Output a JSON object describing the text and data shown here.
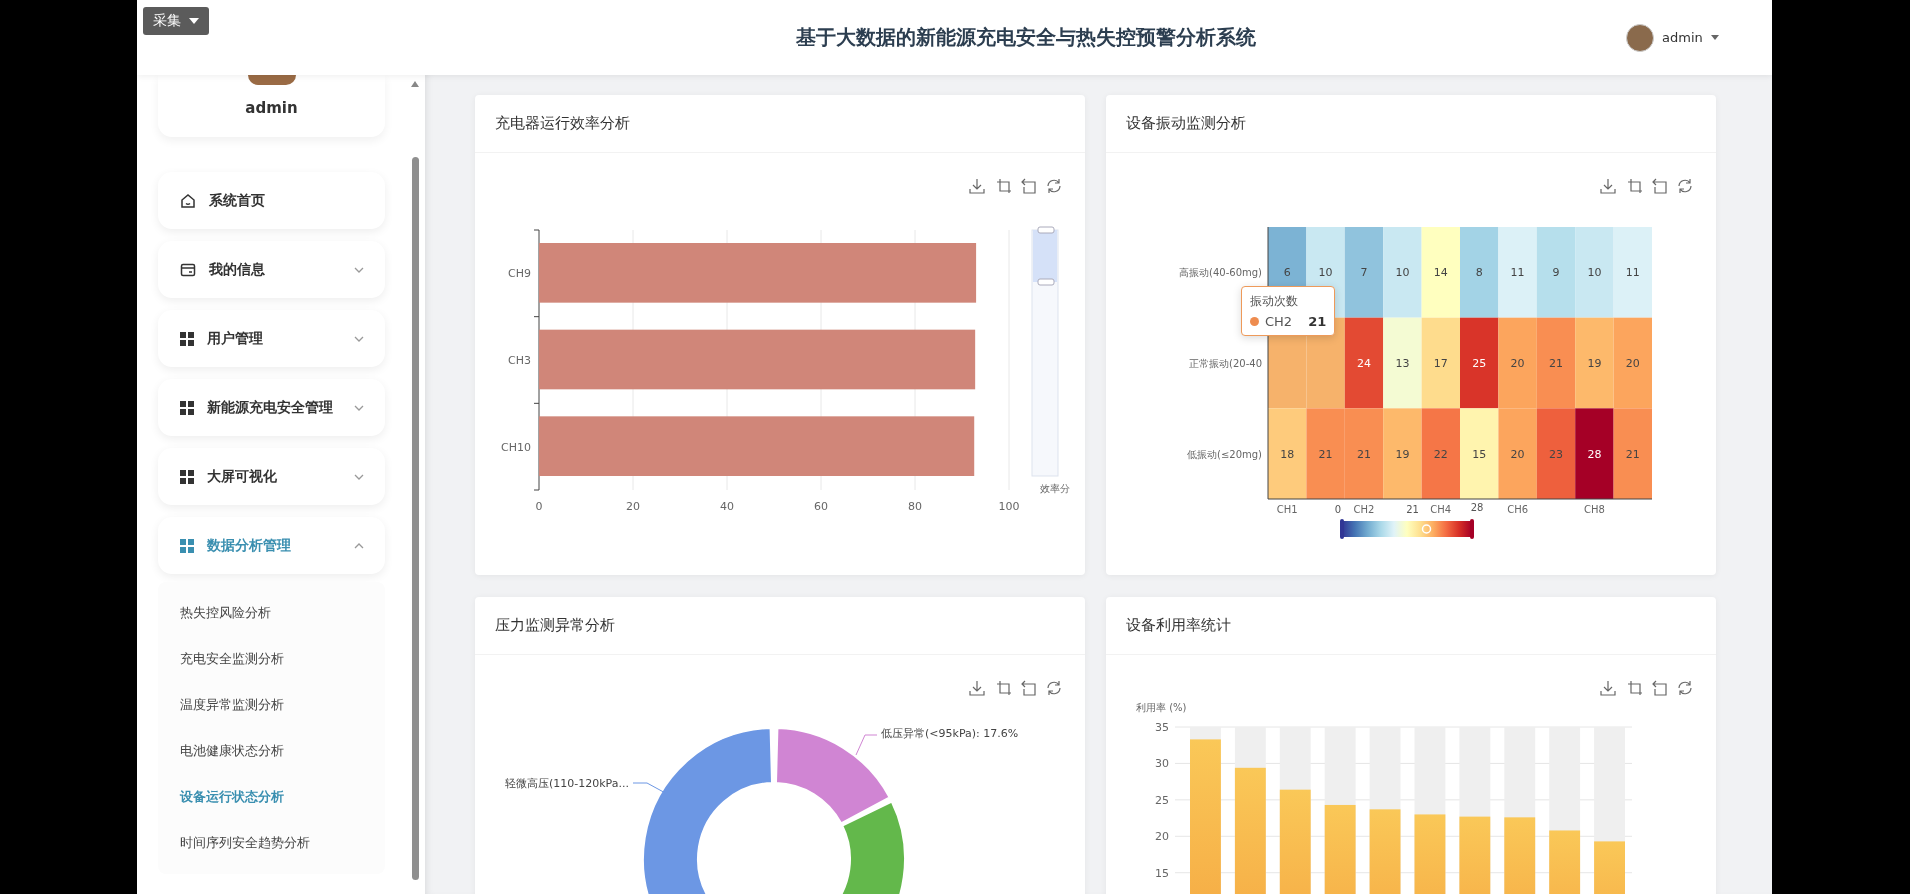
{
  "top_button": {
    "label": "采集"
  },
  "header": {
    "title": "基于大数据的新能源充电安全与热失控预警分析系统",
    "user": "admin"
  },
  "sidebar": {
    "profile": {
      "name": "admin"
    },
    "menu": [
      {
        "label": "系统首页",
        "kind": "home"
      },
      {
        "label": "我的信息",
        "kind": "card",
        "expanded": false
      },
      {
        "label": "用户管理",
        "kind": "grid",
        "expanded": false
      },
      {
        "label": "新能源充电安全管理",
        "kind": "grid",
        "expanded": false
      },
      {
        "label": "大屏可视化",
        "kind": "grid",
        "expanded": false
      },
      {
        "label": "数据分析管理",
        "kind": "grid",
        "expanded": true,
        "children": [
          {
            "label": "热失控风险分析",
            "selected": false
          },
          {
            "label": "充电安全监测分析",
            "selected": false
          },
          {
            "label": "温度异常监测分析",
            "selected": false
          },
          {
            "label": "电池健康状态分析",
            "selected": false
          },
          {
            "label": "设备运行状态分析",
            "selected": true
          },
          {
            "label": "时间序列安全趋势分析",
            "selected": false
          }
        ]
      }
    ]
  },
  "cards": [
    {
      "kind": "hbar",
      "title": "充电器运行效率分析",
      "slider_label": "效率分",
      "chart_data": {
        "type": "bar",
        "orientation": "horizontal",
        "categories": [
          "CH9",
          "CH3",
          "CH10"
        ],
        "values": [
          93,
          92.8,
          92.6
        ],
        "grid": true,
        "xlim": [
          0,
          100
        ],
        "xticks": [
          0,
          20,
          40,
          60,
          80,
          100
        ]
      }
    },
    {
      "kind": "heatmap",
      "title": "设备振动监测分析",
      "y_categories": [
        "高振动(40-60mg)",
        "正常振动(20-40",
        "低振动(≤20mg)"
      ],
      "rows": [
        [
          "6",
          "10",
          "7",
          "10",
          "14",
          "8",
          "11",
          "9",
          "10",
          "11"
        ],
        [
          null,
          null,
          "24",
          "13",
          "17",
          "25",
          "20",
          "21",
          "19",
          "20"
        ],
        [
          "18",
          "21",
          "21",
          "19",
          "22",
          "15",
          "20",
          "23",
          "28",
          "21"
        ]
      ],
      "x_labels": [
        "CH1",
        "CH2",
        "CH4",
        "CH6",
        "CH8"
      ],
      "visual_map": {
        "min": "0",
        "max": "28",
        "handle": "21",
        "level": 0.65
      },
      "tooltip": {
        "title": "振动次数",
        "series": "CH2",
        "value": "21"
      }
    },
    {
      "kind": "donut",
      "title": "压力监测异常分析",
      "labels": [
        "低压异常(<95kPa): 17.6%",
        "轻微高压(110-120kPa..."
      ]
    },
    {
      "kind": "column",
      "title": "设备利用率统计",
      "chart_data": {
        "type": "bar",
        "ylabel": "利用率 (%)",
        "grid": true,
        "values": [
          33.3,
          29.4,
          26.4,
          24.3,
          23.7,
          23.0,
          22.7,
          22.6,
          20.8,
          19.3
        ],
        "ylim": [
          0,
          35
        ],
        "yticks": [
          15,
          20,
          25,
          30,
          35
        ]
      }
    }
  ]
}
